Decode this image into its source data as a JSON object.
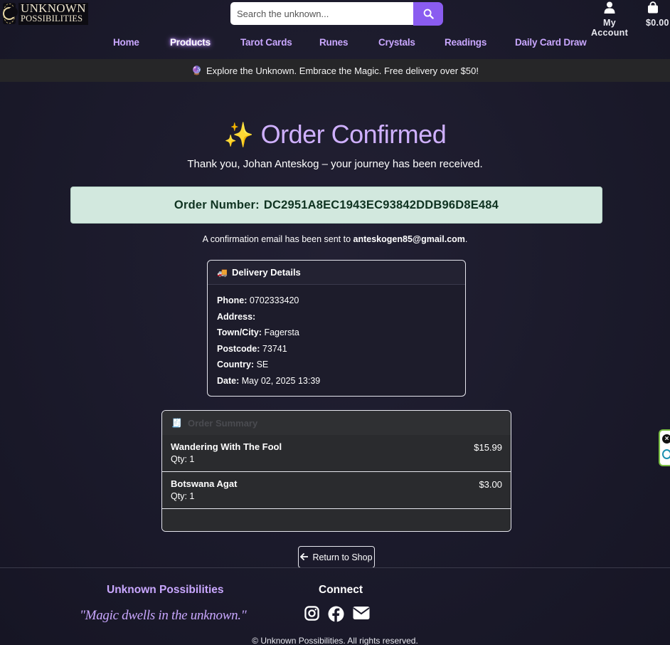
{
  "brand": {
    "line1": "UNKNOWN",
    "line2": "POSSIBILITIES"
  },
  "search": {
    "placeholder": "Search the unknown..."
  },
  "header": {
    "account_label": "My Account",
    "cart_total": "$0.00"
  },
  "nav": {
    "items": [
      {
        "label": "Home"
      },
      {
        "label": "Products"
      },
      {
        "label": "Tarot Cards"
      },
      {
        "label": "Runes"
      },
      {
        "label": "Crystals"
      },
      {
        "label": "Readings"
      },
      {
        "label": "Daily Card Draw"
      }
    ],
    "active": "Products"
  },
  "promo": {
    "emoji": "🔮",
    "text": "Explore the Unknown. Embrace the Magic. Free delivery over $50!"
  },
  "confirmation": {
    "title_emoji": "✨",
    "title": "Order Confirmed",
    "thanks": "Thank you, Johan Anteskog – your journey has been received.",
    "order_number_label": "Order Number:",
    "order_number": "DC2951A8EC1943EC93842DDB96D8E484",
    "email_prefix": "A confirmation email has been sent to",
    "email": "anteskogen85@gmail.com",
    "email_suffix": "."
  },
  "delivery": {
    "header_icon": "🚚",
    "header": "Delivery Details",
    "rows": [
      {
        "label": "Phone:",
        "value": "0702333420"
      },
      {
        "label": "Address:",
        "value": ""
      },
      {
        "label": "Town/City:",
        "value": "Fagersta"
      },
      {
        "label": "Postcode:",
        "value": "73741"
      },
      {
        "label": "Country:",
        "value": "SE"
      },
      {
        "label": "Date:",
        "value": "May 02, 2025 13:39"
      }
    ]
  },
  "summary": {
    "header_icon": "🧾",
    "header": "Order Summary",
    "items": [
      {
        "name": "Wandering With The Fool",
        "qty": "Qty: 1",
        "price": "$15.99"
      },
      {
        "name": "Botswana Agat",
        "qty": "Qty: 1",
        "price": "$3.00"
      }
    ]
  },
  "actions": {
    "return_label": "Return to Shop"
  },
  "footer": {
    "brand": "Unknown Possibilities",
    "quote": "\"Magic dwells in the unknown.\"",
    "connect": "Connect",
    "icons": [
      "instagram-icon",
      "facebook-icon",
      "envelope-icon"
    ],
    "copyright": "© Unknown Possibilities. All rights reserved."
  },
  "colors": {
    "accent": "#c9a7ff",
    "button": "#8a5cf0",
    "order_box_bg": "#d2e8de",
    "background": "#1b1a2b"
  }
}
